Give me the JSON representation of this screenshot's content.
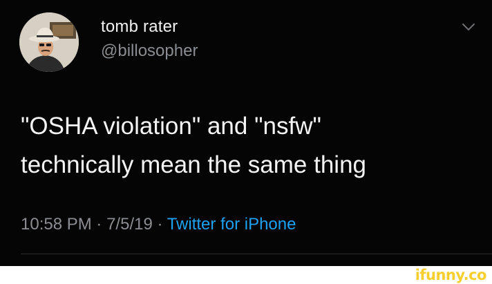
{
  "author": {
    "display_name": "tomb rater",
    "handle": "@billosopher"
  },
  "tweet": {
    "line1": "\"OSHA violation\" and \"nsfw\"",
    "line2": "technically mean the same thing"
  },
  "meta": {
    "time": "10:58 PM",
    "separator": "·",
    "date": "7/5/19",
    "source": "Twitter for iPhone"
  },
  "watermark": "ifunny.co",
  "icons": {
    "chevron": "chevron-down-icon",
    "avatar": "avatar"
  },
  "colors": {
    "background": "#000000",
    "link": "#1da1f2",
    "muted": "#8a8d91",
    "watermark": "#f6cf2d"
  }
}
